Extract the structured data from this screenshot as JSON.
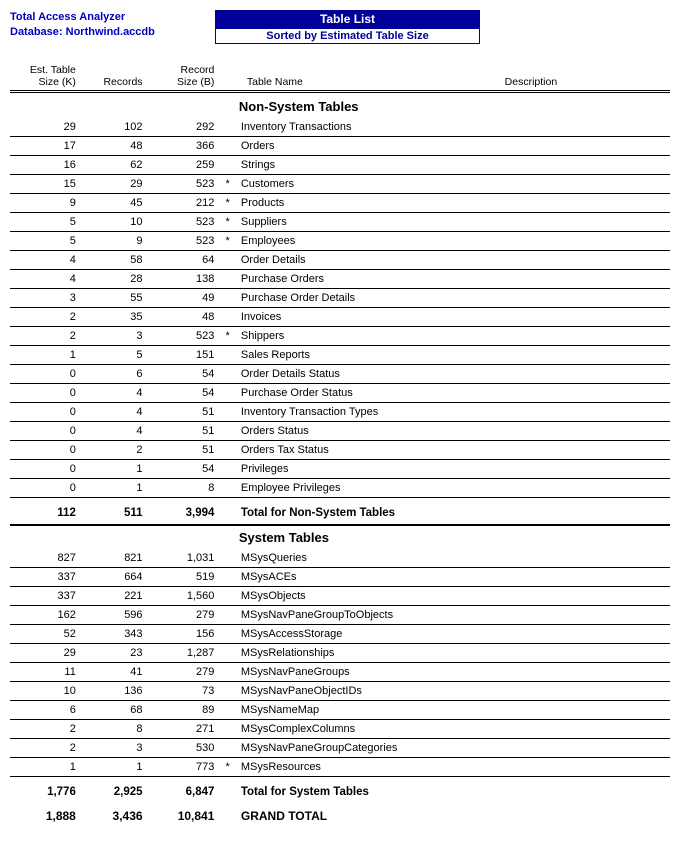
{
  "header": {
    "app_title": "Total Access Analyzer",
    "database_label": "Database: Northwind.accdb",
    "report_title": "Table List",
    "report_subtitle": "Sorted by Estimated Table Size"
  },
  "columns": {
    "col1a": "Est. Table",
    "col1b": "Size (K)",
    "col2": "Records",
    "col3a": "Record",
    "col3b": "Size (B)",
    "col4": "Table Name",
    "col5": "Description"
  },
  "sections": [
    {
      "title": "Non-System Tables",
      "rows": [
        {
          "size": "29",
          "records": "102",
          "rsize": "292",
          "star": "",
          "name": "Inventory Transactions",
          "desc": ""
        },
        {
          "size": "17",
          "records": "48",
          "rsize": "366",
          "star": "",
          "name": "Orders",
          "desc": ""
        },
        {
          "size": "16",
          "records": "62",
          "rsize": "259",
          "star": "",
          "name": "Strings",
          "desc": ""
        },
        {
          "size": "15",
          "records": "29",
          "rsize": "523",
          "star": "*",
          "name": "Customers",
          "desc": ""
        },
        {
          "size": "9",
          "records": "45",
          "rsize": "212",
          "star": "*",
          "name": "Products",
          "desc": ""
        },
        {
          "size": "5",
          "records": "10",
          "rsize": "523",
          "star": "*",
          "name": "Suppliers",
          "desc": ""
        },
        {
          "size": "5",
          "records": "9",
          "rsize": "523",
          "star": "*",
          "name": "Employees",
          "desc": ""
        },
        {
          "size": "4",
          "records": "58",
          "rsize": "64",
          "star": "",
          "name": "Order Details",
          "desc": ""
        },
        {
          "size": "4",
          "records": "28",
          "rsize": "138",
          "star": "",
          "name": "Purchase Orders",
          "desc": ""
        },
        {
          "size": "3",
          "records": "55",
          "rsize": "49",
          "star": "",
          "name": "Purchase Order Details",
          "desc": ""
        },
        {
          "size": "2",
          "records": "35",
          "rsize": "48",
          "star": "",
          "name": "Invoices",
          "desc": ""
        },
        {
          "size": "2",
          "records": "3",
          "rsize": "523",
          "star": "*",
          "name": "Shippers",
          "desc": ""
        },
        {
          "size": "1",
          "records": "5",
          "rsize": "151",
          "star": "",
          "name": "Sales Reports",
          "desc": ""
        },
        {
          "size": "0",
          "records": "6",
          "rsize": "54",
          "star": "",
          "name": "Order Details Status",
          "desc": ""
        },
        {
          "size": "0",
          "records": "4",
          "rsize": "54",
          "star": "",
          "name": "Purchase Order Status",
          "desc": ""
        },
        {
          "size": "0",
          "records": "4",
          "rsize": "51",
          "star": "",
          "name": "Inventory Transaction Types",
          "desc": ""
        },
        {
          "size": "0",
          "records": "4",
          "rsize": "51",
          "star": "",
          "name": "Orders Status",
          "desc": ""
        },
        {
          "size": "0",
          "records": "2",
          "rsize": "51",
          "star": "",
          "name": "Orders Tax Status",
          "desc": ""
        },
        {
          "size": "0",
          "records": "1",
          "rsize": "54",
          "star": "",
          "name": "Privileges",
          "desc": ""
        },
        {
          "size": "0",
          "records": "1",
          "rsize": "8",
          "star": "",
          "name": "Employee Privileges",
          "desc": ""
        }
      ],
      "subtotal": {
        "size": "112",
        "records": "511",
        "rsize": "3,994",
        "label": "Total for Non-System Tables"
      }
    },
    {
      "title": "System Tables",
      "rows": [
        {
          "size": "827",
          "records": "821",
          "rsize": "1,031",
          "star": "",
          "name": "MSysQueries",
          "desc": ""
        },
        {
          "size": "337",
          "records": "664",
          "rsize": "519",
          "star": "",
          "name": "MSysACEs",
          "desc": ""
        },
        {
          "size": "337",
          "records": "221",
          "rsize": "1,560",
          "star": "",
          "name": "MSysObjects",
          "desc": ""
        },
        {
          "size": "162",
          "records": "596",
          "rsize": "279",
          "star": "",
          "name": "MSysNavPaneGroupToObjects",
          "desc": ""
        },
        {
          "size": "52",
          "records": "343",
          "rsize": "156",
          "star": "",
          "name": "MSysAccessStorage",
          "desc": ""
        },
        {
          "size": "29",
          "records": "23",
          "rsize": "1,287",
          "star": "",
          "name": "MSysRelationships",
          "desc": ""
        },
        {
          "size": "11",
          "records": "41",
          "rsize": "279",
          "star": "",
          "name": "MSysNavPaneGroups",
          "desc": ""
        },
        {
          "size": "10",
          "records": "136",
          "rsize": "73",
          "star": "",
          "name": "MSysNavPaneObjectIDs",
          "desc": ""
        },
        {
          "size": "6",
          "records": "68",
          "rsize": "89",
          "star": "",
          "name": "MSysNameMap",
          "desc": ""
        },
        {
          "size": "2",
          "records": "8",
          "rsize": "271",
          "star": "",
          "name": "MSysComplexColumns",
          "desc": ""
        },
        {
          "size": "2",
          "records": "3",
          "rsize": "530",
          "star": "",
          "name": "MSysNavPaneGroupCategories",
          "desc": ""
        },
        {
          "size": "1",
          "records": "1",
          "rsize": "773",
          "star": "*",
          "name": "MSysResources",
          "desc": ""
        }
      ],
      "subtotal": {
        "size": "1,776",
        "records": "2,925",
        "rsize": "6,847",
        "label": "Total for System Tables"
      }
    }
  ],
  "grand_total": {
    "size": "1,888",
    "records": "3,436",
    "rsize": "10,841",
    "label": "GRAND TOTAL"
  }
}
